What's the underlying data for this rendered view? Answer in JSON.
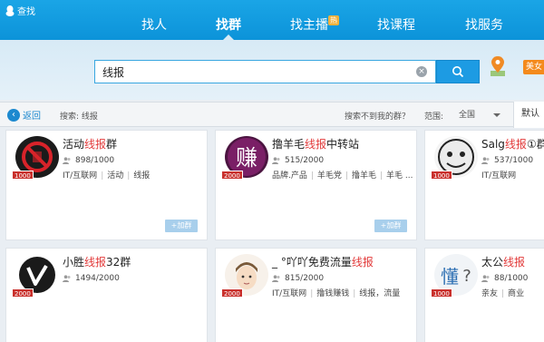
{
  "brand": {
    "name": "查找"
  },
  "nav": {
    "items": [
      {
        "label": "找人"
      },
      {
        "label": "找群"
      },
      {
        "label": "找主播",
        "badge": "热"
      },
      {
        "label": "找课程"
      },
      {
        "label": "找服务"
      }
    ],
    "active_index": 1
  },
  "search": {
    "value": "线报",
    "clear": "×"
  },
  "tag": {
    "label": "美女"
  },
  "filter": {
    "back_label": "返回",
    "keyword_text": "搜索: 线报",
    "not_found": "搜索不到我的群？",
    "range_label": "范围:",
    "range_value": "全国",
    "sort_label": "默认"
  },
  "cards": [
    {
      "title_pre": "活动",
      "title_hl": "线报",
      "title_post": "群",
      "members": "898/1000",
      "badge": "1000",
      "tags": [
        "IT/互联网",
        "活动",
        "线报"
      ],
      "join": "+加群"
    },
    {
      "title_pre": "撸羊毛",
      "title_hl": "线报",
      "title_post": "中转站",
      "members": "515/2000",
      "badge": "2000",
      "tags": [
        "品牌.产品",
        "羊毛党",
        "撸羊毛",
        "羊毛 ..."
      ],
      "join": "+加群"
    },
    {
      "title_pre": "Salg",
      "title_hl": "线报",
      "title_post": "①群",
      "members": "537/1000",
      "badge": "1000",
      "tags": [
        "IT/互联网"
      ],
      "join": ""
    },
    {
      "title_pre": "小胜",
      "title_hl": "线报",
      "title_post": "32群",
      "members": "1494/2000",
      "badge": "2000",
      "tags": [],
      "join": ""
    },
    {
      "title_pre": "_ °吖吖免费流量",
      "title_hl": "线报",
      "title_post": "",
      "members": "815/2000",
      "badge": "2000",
      "tags": [
        "IT/互联网",
        "撸钱赚钱",
        "线报，流量"
      ],
      "join": ""
    },
    {
      "title_pre": "太公",
      "title_hl": "线报",
      "title_post": "",
      "members": "88/1000",
      "badge": "1000",
      "tags": [
        "亲友",
        "商业"
      ],
      "join": ""
    }
  ],
  "colors": {
    "nav_blue": "#0c93d9",
    "highlight_red": "#e23a3a",
    "badge_red": "#c9302c"
  }
}
